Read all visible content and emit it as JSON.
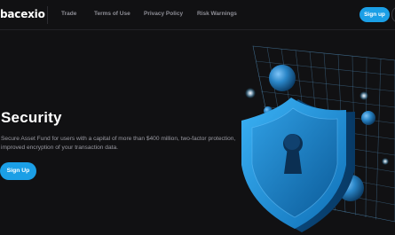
{
  "header": {
    "logo": "bacexio",
    "nav": [
      "Trade",
      "Terms of Use",
      "Privacy Policy",
      "Risk Warnings"
    ],
    "signup_label": "Sign up"
  },
  "hero": {
    "title": "Security",
    "description": "Secure Asset Fund for users with a capital of more than $400 million, two-factor protection, improved encryption of your transaction data.",
    "signup_label": "Sign Up"
  },
  "colors": {
    "background": "#111113",
    "accent": "#1b9fe6",
    "muted_text": "#8e8e96"
  },
  "icons": [
    "shield-icon",
    "keyhole-icon"
  ]
}
